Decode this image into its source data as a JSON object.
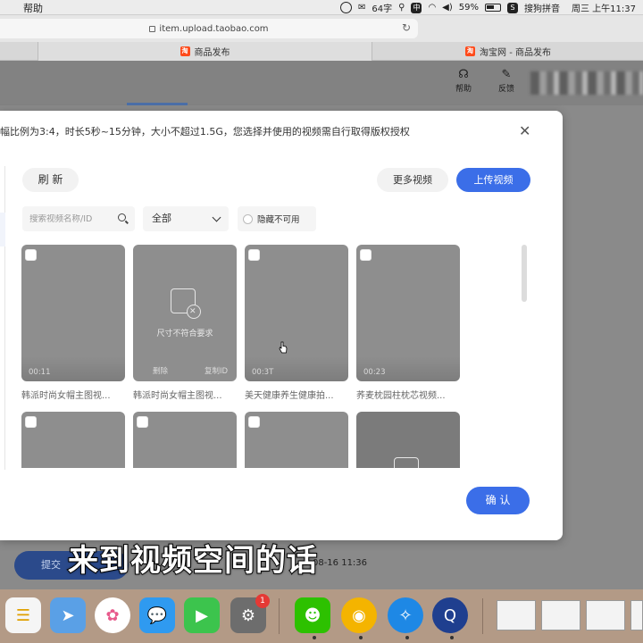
{
  "menubar": {
    "help": "帮助",
    "ime_status": "64字",
    "battery": "59%",
    "input_method": "搜狗拼音",
    "clock": "周三 上午11:37"
  },
  "browser": {
    "url": "item.upload.taobao.com",
    "tabs": [
      {
        "label": "商品发布"
      },
      {
        "label": "淘宝网 - 商品发布"
      }
    ]
  },
  "page": {
    "header_items": [
      {
        "label": "帮助",
        "icon": "headset-icon"
      },
      {
        "label": "反馈",
        "icon": "feedback-icon"
      }
    ],
    "submit_label": "提交",
    "date_text": "3-08-16 11:36"
  },
  "modal": {
    "title": "幅比例为3:4，时长5秒~15分钟，大小不超过1.5G，您选择并使用的视频需自行取得版权授权",
    "refresh_label": "刷 新",
    "more_videos_label": "更多视频",
    "upload_label": "上传视频",
    "search_placeholder": "搜索视频名称/ID",
    "filter_selected": "全部",
    "hide_unavailable_label": "隐藏不可用",
    "confirm_label": "确 认",
    "videos": [
      {
        "duration": "00:11",
        "title": "韩派时尚女帽主图视..."
      },
      {
        "status": "尺寸不符合要求",
        "delete_label": "删除",
        "copy_id_label": "复制ID",
        "title": "韩派时尚女帽主图视..."
      },
      {
        "duration": "00:3T",
        "title": "美天健康养生健康拍..."
      },
      {
        "duration": "00:23",
        "title": "荞麦枕园柱枕芯视频..."
      },
      {},
      {},
      {},
      {}
    ]
  },
  "subtitle": "来到视频空间的话",
  "dock": {
    "mail_badge": "1"
  },
  "colors": {
    "accent": "#3b6ee8",
    "taobao": "#ff4a1a"
  }
}
